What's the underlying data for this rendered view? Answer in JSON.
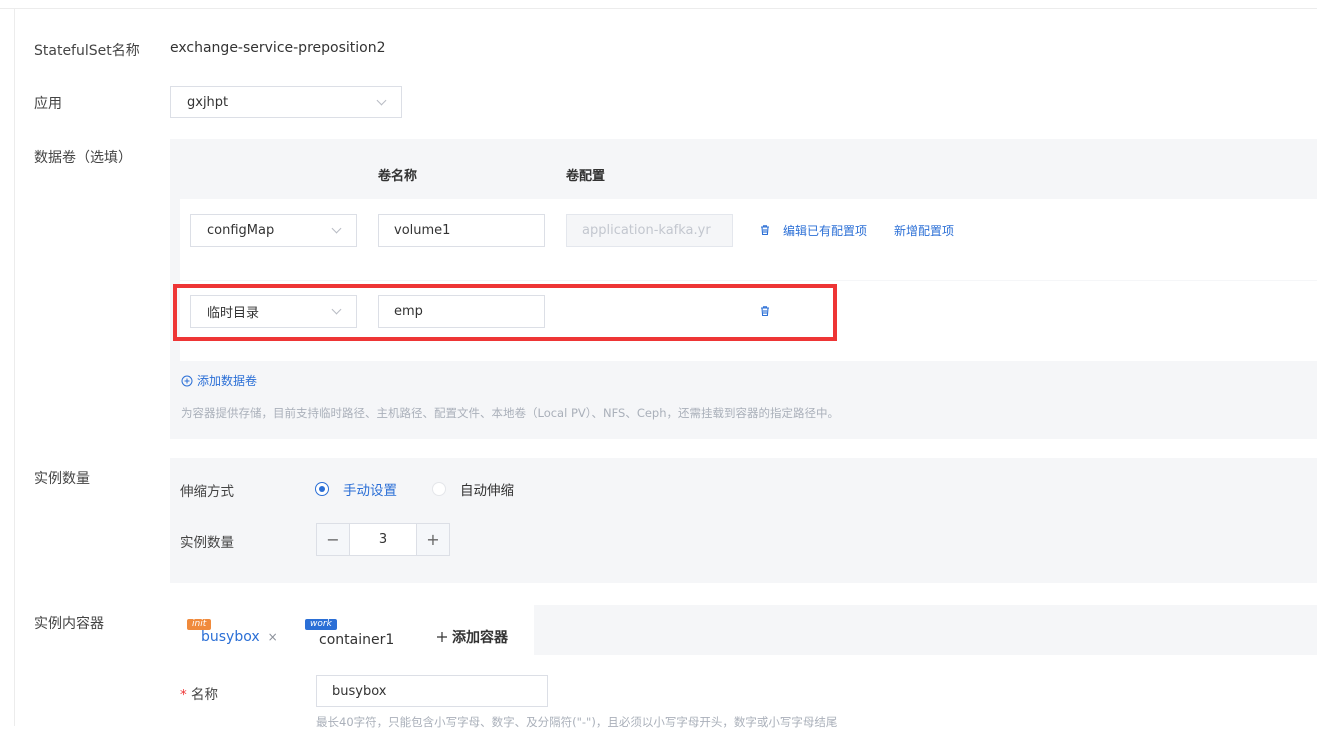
{
  "form": {
    "name_label": "StatefulSet名称",
    "name_value": "exchange-service-preposition2",
    "app_label": "应用",
    "app_value": "gxjhpt",
    "volumes_label": "数据卷（选填）",
    "replicas_label": "实例数量",
    "containers_label": "实例内容器"
  },
  "volumes": {
    "col_name": "卷名称",
    "col_config": "卷配置",
    "rows": [
      {
        "type": "configMap",
        "name": "volume1",
        "config": "application-kafka.yr",
        "edit_link": "编辑已有配置项",
        "add_link": "新增配置项"
      },
      {
        "type": "临时目录",
        "name": "emp"
      }
    ],
    "add_label": "添加数据卷",
    "help": "为容器提供存储，目前支持临时路径、主机路径、配置文件、本地卷（Local PV）、NFS、Ceph，还需挂载到容器的指定路径中。"
  },
  "scaling": {
    "mode_label": "伸缩方式",
    "manual": "手动设置",
    "auto": "自动伸缩",
    "count_label": "实例数量",
    "count": "3",
    "minus": "−",
    "plus": "+"
  },
  "containers": {
    "tabs": [
      {
        "tag": "init",
        "name": "busybox",
        "close": "×"
      },
      {
        "tag": "work",
        "name": "container1"
      }
    ],
    "add_label": "添加容器",
    "name_required": "*",
    "name_label": "名称",
    "name_value": "busybox",
    "name_help": "最长40字符，只能包含小写字母、数字、及分隔符(\"-\")，且必须以小写字母开头，数字或小写字母结尾"
  },
  "icons": {
    "trash": "trash-icon",
    "chevron": "chevron-down-icon",
    "add": "plus-circle-icon"
  },
  "colors": {
    "primary": "#2b6fd6",
    "highlight": "#ee3535",
    "init_tag": "#f08a3c"
  }
}
